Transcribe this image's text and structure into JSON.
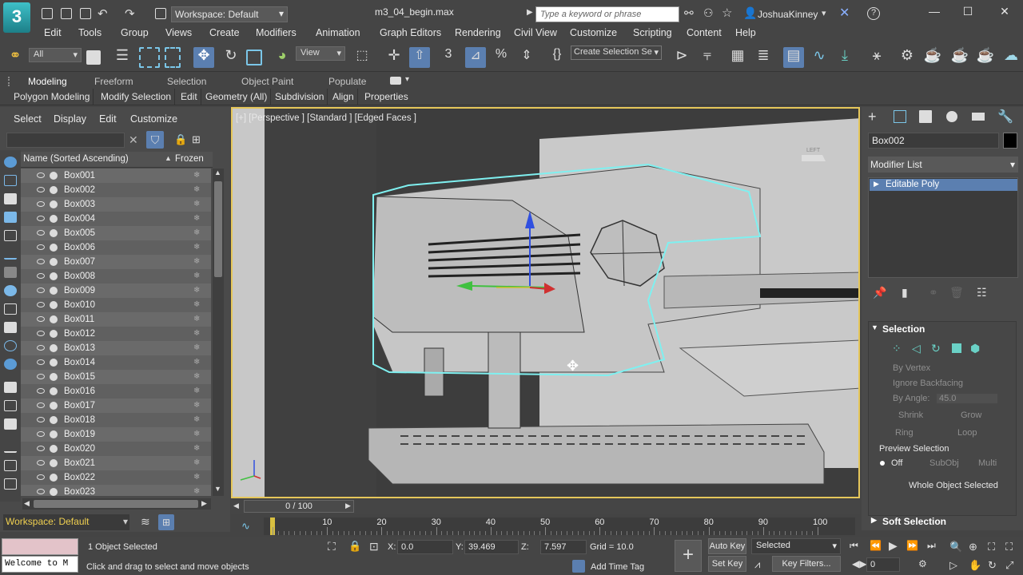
{
  "app": {
    "logo_text": "3",
    "workspace": "Workspace: Default",
    "filename": "m3_04_begin.max",
    "search_placeholder": "Type a keyword or phrase",
    "user": "JoshuaKinney"
  },
  "menu": [
    "Edit",
    "Tools",
    "Group",
    "Views",
    "Create",
    "Modifiers",
    "Animation",
    "Graph Editors",
    "Rendering",
    "Civil View",
    "Customize",
    "Scripting",
    "Content",
    "Help"
  ],
  "toolbar": {
    "filter": "All",
    "ref_coord": "View",
    "selection_set": "Create Selection Se"
  },
  "ribbon": {
    "tabs": [
      "Modeling",
      "Freeform",
      "Selection",
      "Object Paint",
      "Populate"
    ],
    "subtabs": [
      "Polygon Modeling",
      "Modify Selection",
      "Edit",
      "Geometry (All)",
      "Subdivision",
      "Align",
      "Properties"
    ]
  },
  "explorer": {
    "tabs": [
      "Select",
      "Display",
      "Edit",
      "Customize"
    ],
    "col_name": "Name (Sorted Ascending)",
    "col_frozen": "Frozen",
    "rows": [
      "Box001",
      "Box002",
      "Box003",
      "Box004",
      "Box005",
      "Box006",
      "Box007",
      "Box008",
      "Box009",
      "Box010",
      "Box011",
      "Box012",
      "Box013",
      "Box014",
      "Box015",
      "Box016",
      "Box017",
      "Box018",
      "Box019",
      "Box020",
      "Box021",
      "Box022",
      "Box023"
    ],
    "workspace_bottom": "Workspace: Default"
  },
  "viewport": {
    "label": "[+] [Perspective ] [Standard ] [Edged Faces ]",
    "viewcube": "LEFT"
  },
  "command_panel": {
    "object_name": "Box002",
    "modifier_list": "Modifier List",
    "stack_item": "Editable Poly",
    "selection_title": "Selection",
    "by_vertex": "By Vertex",
    "ignore_backfacing": "Ignore Backfacing",
    "by_angle": "By Angle:",
    "angle_value": "45.0",
    "shrink": "Shrink",
    "grow": "Grow",
    "ring": "Ring",
    "loop": "Loop",
    "preview_selection": "Preview Selection",
    "preview_off": "Off",
    "preview_subobj": "SubObj",
    "preview_multi": "Multi",
    "whole_object": "Whole Object Selected",
    "soft_selection": "Soft Selection"
  },
  "timeline": {
    "frame": "0 / 100",
    "ticks": [
      "0",
      "10",
      "20",
      "30",
      "40",
      "50",
      "60",
      "70",
      "80",
      "90",
      "100"
    ]
  },
  "status": {
    "maxscript": "Welcome to M",
    "objects_selected": "1 Object Selected",
    "prompt": "Click and drag to select and move objects",
    "x_label": "X:",
    "x": "0.0",
    "y_label": "Y:",
    "y": "39.469",
    "z_label": "Z:",
    "z": "7.597",
    "grid": "Grid = 10.0",
    "add_time_tag": "Add Time Tag",
    "auto_key": "Auto Key",
    "set_key": "Set Key",
    "key_mode": "Selected",
    "key_filters": "Key Filters...",
    "current_frame": "0"
  },
  "colors": {
    "accent": "#5b7fb0",
    "selection_wire": "#7ff0f0",
    "viewport_border": "#e6c75a"
  }
}
